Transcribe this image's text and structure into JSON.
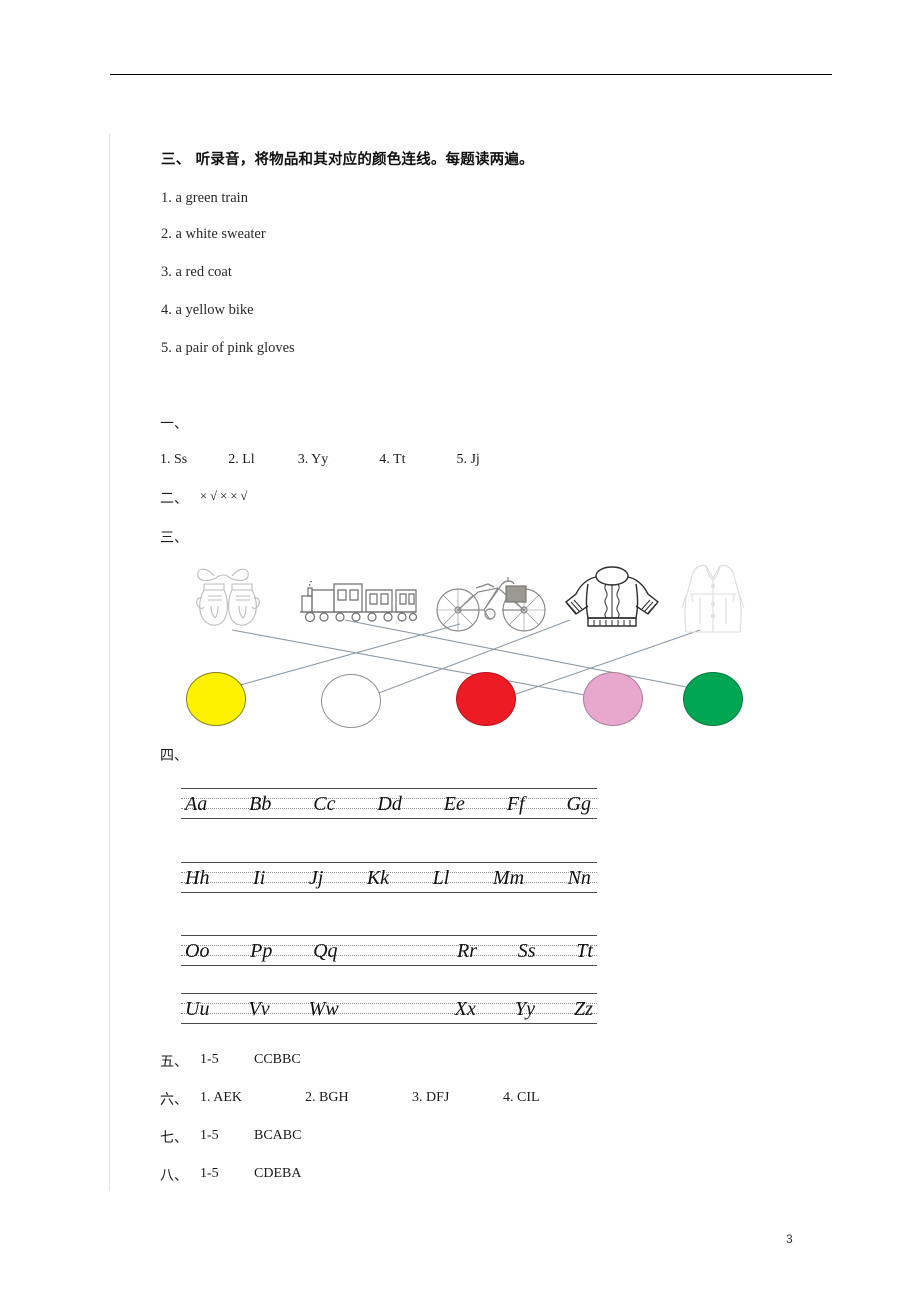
{
  "document": {
    "page_number": "3"
  },
  "listening_section": {
    "heading": "三、 听录音，将物品和其对应的颜色连线。每题读两遍。",
    "items": [
      "1. a green train",
      "2. a white sweater",
      "3. a red coat",
      "4. a yellow bike",
      "5. a pair of pink gloves"
    ]
  },
  "answer_key": {
    "section1": {
      "label": "一、",
      "answers": [
        "1. Ss",
        "2. Ll",
        "3. Yy",
        "4. Tt",
        "5. Jj"
      ]
    },
    "section2": {
      "label": "二、",
      "answer": "× √ × × √"
    },
    "section3": {
      "label": "三、"
    },
    "section4": {
      "label": "四、"
    },
    "section5": {
      "label": "五、",
      "range": "1-5",
      "answer": "CCBBC"
    },
    "section6": {
      "label": "六、",
      "answers": [
        "1. AEK",
        "2. BGH",
        "3. DFJ",
        "4. CIL"
      ]
    },
    "section7": {
      "label": "七、",
      "range": "1-5",
      "answer": "BCABC"
    },
    "section8": {
      "label": "八、",
      "range": "1-5",
      "answer": "CDEBA"
    }
  },
  "matching": {
    "items": [
      {
        "name": "gloves",
        "label": "gloves"
      },
      {
        "name": "train",
        "label": "train"
      },
      {
        "name": "bike",
        "label": "bike"
      },
      {
        "name": "sweater",
        "label": "sweater"
      },
      {
        "name": "coat",
        "label": "coat"
      }
    ],
    "colors": [
      {
        "name": "yellow",
        "hex": "#FFF200",
        "stroke": "#8a8216"
      },
      {
        "name": "white",
        "hex": "#FFFFFF",
        "stroke": "#8f8f96"
      },
      {
        "name": "red",
        "hex": "#ED1B24",
        "stroke": "#b5141b"
      },
      {
        "name": "pink",
        "hex": "#E8A8CE",
        "stroke": "#a87f97"
      },
      {
        "name": "green",
        "hex": "#00A651",
        "stroke": "#007c3d"
      }
    ],
    "line_color": "#8d9aa5"
  },
  "handwriting": {
    "rows": [
      {
        "letters": [
          "Aa",
          "Bb",
          "Cc",
          "Dd",
          "Ee",
          "Ff",
          "Gg"
        ]
      },
      {
        "letters": [
          "Hh",
          "Ii",
          "Jj",
          "Kk",
          "Ll",
          "Mm",
          "Nn"
        ]
      },
      {
        "letters": [
          "Oo",
          "Pp",
          "Qq",
          "Rr",
          "Ss",
          "Tt"
        ]
      },
      {
        "letters": [
          "Uu",
          "Vv",
          "Ww",
          "Xx",
          "Yy",
          "Zz"
        ]
      }
    ]
  }
}
